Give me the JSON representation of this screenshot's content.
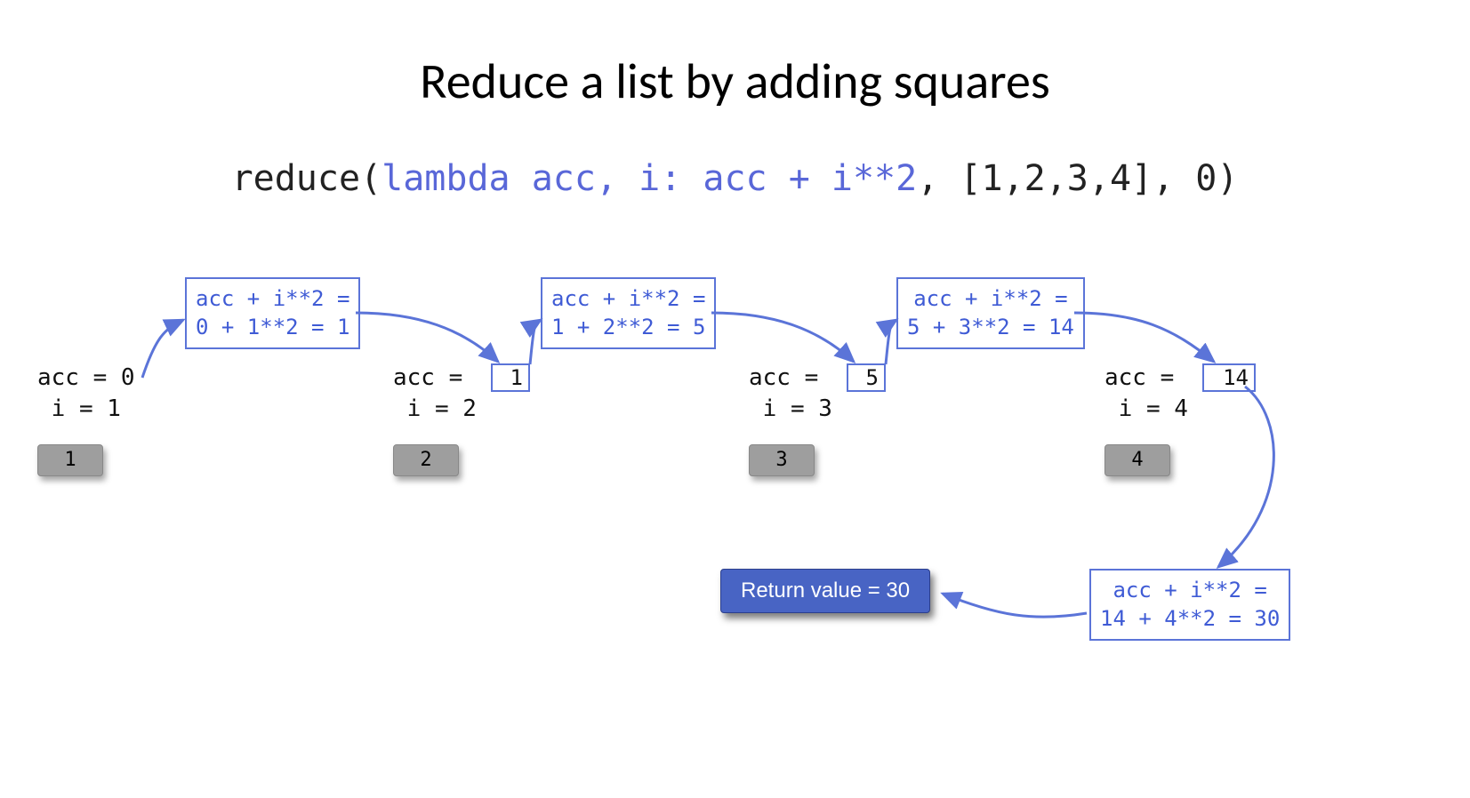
{
  "title": "Reduce a list by adding squares",
  "code": {
    "prefix": "reduce(",
    "lambda": "lambda acc, i: acc + i**2",
    "suffix": ", [1,2,3,4], 0)"
  },
  "steps": [
    {
      "acc_label": "acc = 0",
      "i_label": " i = 1",
      "chip": "1",
      "acc_box": ""
    },
    {
      "acc_label": "acc = ",
      "i_label": " i = 2",
      "chip": "2",
      "acc_box": "1"
    },
    {
      "acc_label": "acc = ",
      "i_label": " i = 3",
      "chip": "3",
      "acc_box": "5"
    },
    {
      "acc_label": "acc = ",
      "i_label": " i = 4",
      "chip": "4",
      "acc_box": "14"
    }
  ],
  "calcs": [
    {
      "line1": "acc + i**2 =",
      "line2": "0 + 1**2 = 1"
    },
    {
      "line1": "acc + i**2 =",
      "line2": "1 + 2**2 = 5"
    },
    {
      "line1": "acc + i**2 =",
      "line2": "5 + 3**2 = 14"
    },
    {
      "line1": "acc + i**2 =",
      "line2": "14 + 4**2 = 30"
    }
  ],
  "return_label": "Return value = 30"
}
